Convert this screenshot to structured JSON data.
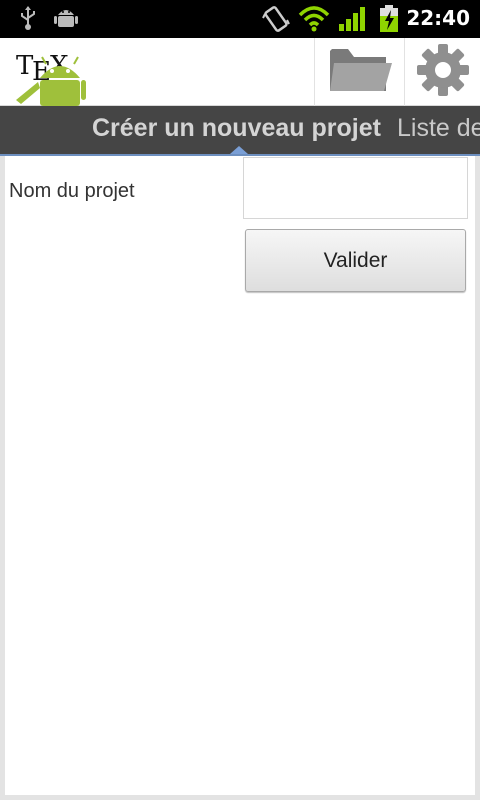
{
  "status_bar": {
    "time": "22:40",
    "icons": [
      "usb-icon",
      "android-debug-icon",
      "vibrate-icon",
      "wifi-icon",
      "signal-icon",
      "battery-charging-icon"
    ]
  },
  "action_bar": {
    "logo_text": "TEX",
    "actions": [
      "folder-icon",
      "settings-icon"
    ]
  },
  "tabs": {
    "active": "Créer un nouveau projet",
    "next": "Liste de"
  },
  "form": {
    "project_name_label": "Nom du projet",
    "project_name_value": "",
    "validate_label": "Valider"
  },
  "colors": {
    "accent": "#7a9fd6",
    "tab_bar": "#454545",
    "android_green": "#9fc03b"
  }
}
